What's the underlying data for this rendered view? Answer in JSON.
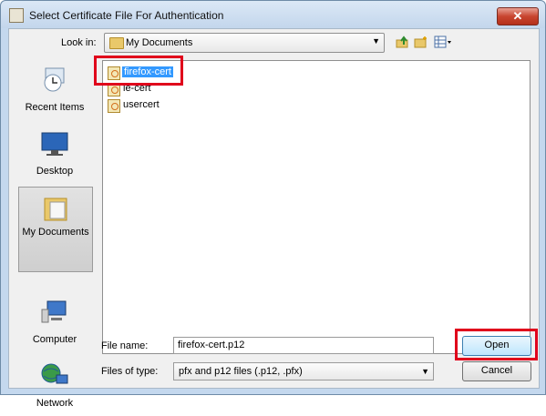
{
  "window": {
    "title": "Select Certificate File For Authentication",
    "close_label": "✕"
  },
  "lookin": {
    "label": "Look in:",
    "value": "My Documents"
  },
  "places": [
    {
      "label": "Recent Items"
    },
    {
      "label": "Desktop"
    },
    {
      "label": "My Documents"
    },
    {
      "label": "Computer"
    },
    {
      "label": "Network"
    }
  ],
  "files": [
    {
      "name": "firefox-cert",
      "selected": true
    },
    {
      "name": "ie-cert",
      "selected": false
    },
    {
      "name": "usercert",
      "selected": false
    }
  ],
  "filename": {
    "label": "File name:",
    "value": "firefox-cert.p12"
  },
  "filetype": {
    "label": "Files of type:",
    "value": "pfx and p12 files (.p12, .pfx)"
  },
  "buttons": {
    "open": "Open",
    "cancel": "Cancel"
  },
  "colors": {
    "highlight": "#e0001b",
    "selection": "#3399ff"
  }
}
